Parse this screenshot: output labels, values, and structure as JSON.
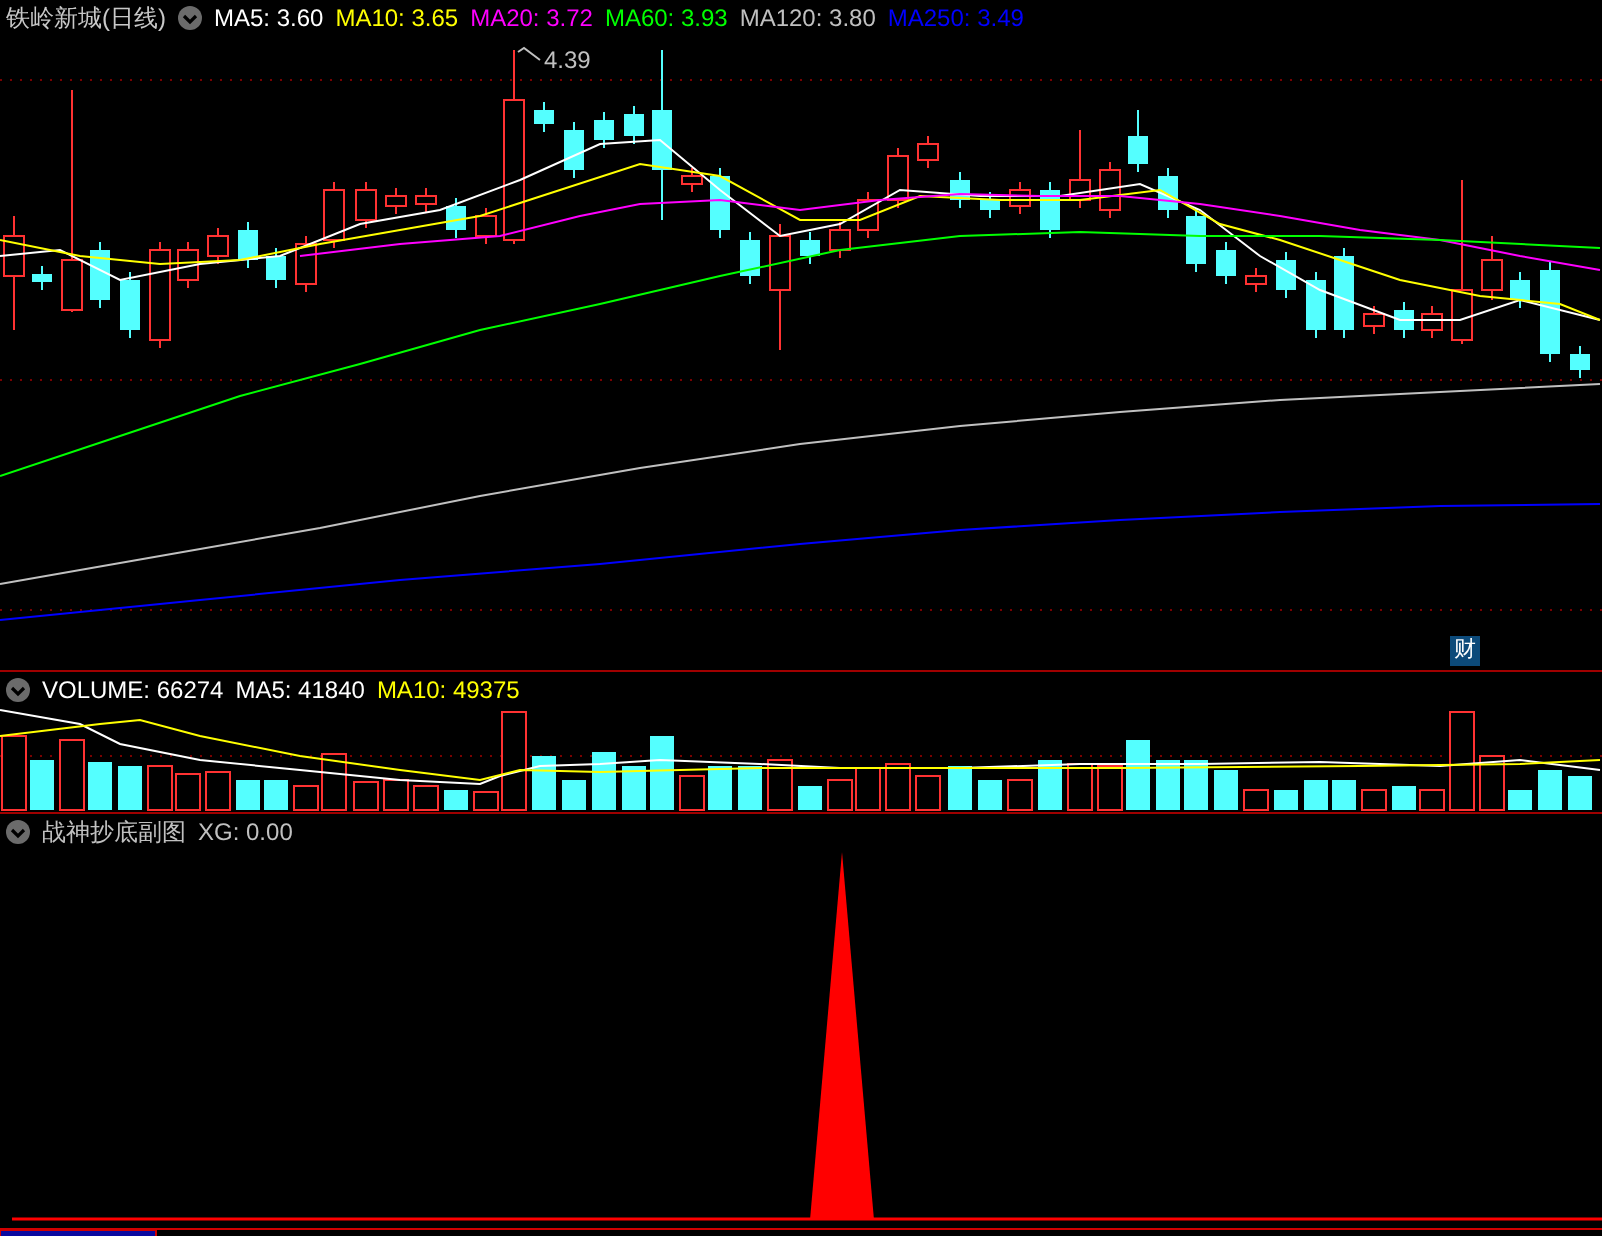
{
  "title": "铁岭新城(日线)",
  "ma_legend": [
    {
      "label": "MA5: 3.60",
      "color": "#ffffff"
    },
    {
      "label": "MA10: 3.65",
      "color": "#ffff00"
    },
    {
      "label": "MA20: 3.72",
      "color": "#ff00ff"
    },
    {
      "label": "MA60: 3.93",
      "color": "#00ff00"
    },
    {
      "label": "MA120: 3.80",
      "color": "#c0c0c0"
    },
    {
      "label": "MA250: 3.49",
      "color": "#0000ff"
    }
  ],
  "price_marker": "4.39",
  "badge": "财",
  "volume_legend": [
    {
      "label": "VOLUME: 66274",
      "color": "#ffffff"
    },
    {
      "label": "MA5: 41840",
      "color": "#ffffff"
    },
    {
      "label": "MA10: 49375",
      "color": "#ffff00"
    }
  ],
  "indicator_legend": [
    {
      "label": "战神抄底副图",
      "color": "#c0c0c0"
    },
    {
      "label": "XG: 0.00",
      "color": "#c0c0c0"
    }
  ]
}
